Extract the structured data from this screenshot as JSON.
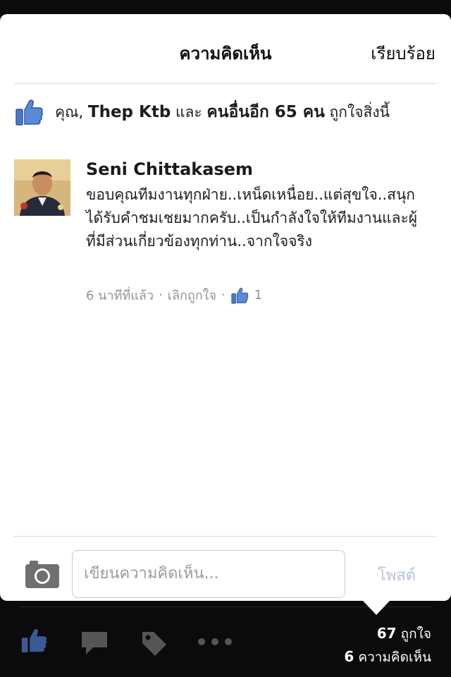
{
  "header": {
    "title": "ความคิดเห็น",
    "done_label": "เรียบร้อย"
  },
  "likes": {
    "prefix": "คุณ, ",
    "person": "Thep Ktb",
    "and_word": " และ ",
    "others": "คนอื่นอีก 65 คน",
    "suffix": " ถูกใจสิ่งนี้",
    "icon": "thumbs-up-icon"
  },
  "comment": {
    "author": "Seni Chittakasem",
    "text": "ขอบคุณทีมงานทุกฝ่าย..เหน็ดเหนื่อย..แต่สุขใจ..สนุกได้รับคำชมเชยมากครับ..เป็นกำลังใจให้ทีมงานและผู้ที่มีส่วนเกี่ยวข้องทุกท่าน..จากใจจริง",
    "time": "6 นาทีที่แล้ว",
    "separator": "·",
    "unlike_label": "เลิกถูกใจ",
    "like_count": "1"
  },
  "composer": {
    "placeholder": "เขียนความคิดเห็น...",
    "post_label": "โพสต์"
  },
  "footer": {
    "likes_count": "67",
    "likes_label": "ถูกใจ",
    "comments_count": "6",
    "comments_label": "ความคิดเห็น",
    "icons": [
      "thumbs-up-icon",
      "comment-icon",
      "tag-icon",
      "more-icon"
    ]
  },
  "colors": {
    "brand_blue": "#3b5998",
    "muted_text": "#8f949b",
    "post_disabled": "#b9c4d6"
  }
}
